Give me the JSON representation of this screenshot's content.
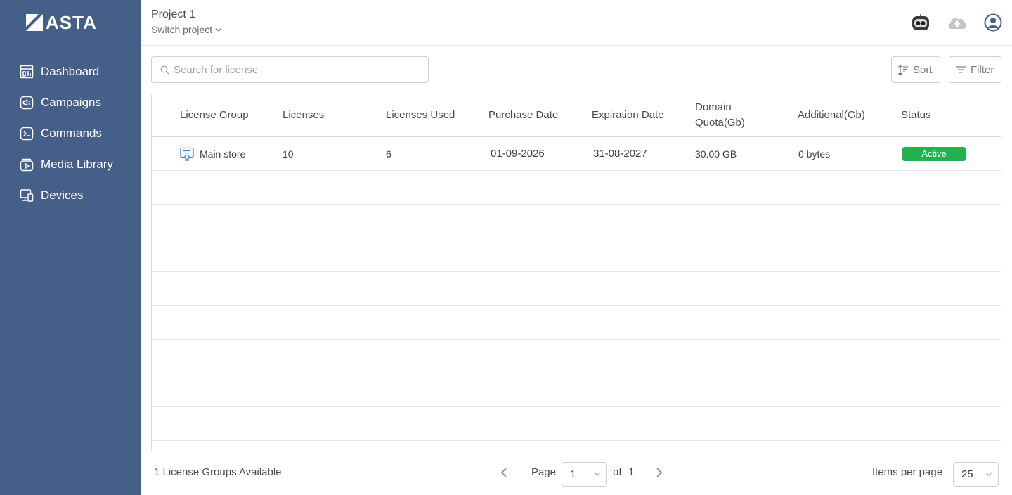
{
  "brand": {
    "name": "ASTA"
  },
  "sidebar": {
    "items": [
      {
        "label": "Dashboard",
        "icon": "dashboard-icon"
      },
      {
        "label": "Campaigns",
        "icon": "campaigns-icon"
      },
      {
        "label": "Commands",
        "icon": "commands-icon"
      },
      {
        "label": "Media Library",
        "icon": "media-library-icon"
      },
      {
        "label": "Devices",
        "icon": "devices-icon"
      }
    ]
  },
  "header": {
    "project_name": "Project 1",
    "switch_label": "Switch project",
    "icons": [
      "robot-icon",
      "cloud-upload-icon",
      "user-avatar-icon"
    ]
  },
  "search": {
    "placeholder": "Search for license",
    "value": ""
  },
  "toolbar": {
    "sort_label": "Sort",
    "filter_label": "Filter"
  },
  "table": {
    "columns": [
      "License Group",
      "Licenses",
      "Licenses Used",
      "Purchase Date",
      "Expiration Date",
      "Domain Quota(Gb)",
      "Additional(Gb)",
      "Status"
    ],
    "rows": [
      {
        "license_group": "Main store",
        "licenses": "10",
        "licenses_used": "6",
        "purchase_date": "01-09-2026",
        "expiration_date": "31-08-2027",
        "domain_quota": "30.00 GB",
        "additional": "0 bytes",
        "status": "Active"
      }
    ]
  },
  "footer": {
    "count_text": "1 License Groups Available",
    "page_label": "Page",
    "current_page": "1",
    "of_label": "of",
    "total_pages": "1",
    "items_per_page_label": "Items per page",
    "items_per_page": "25"
  },
  "colors": {
    "sidebar": "#455f89",
    "status_active": "#22b14c",
    "license_icon": "#3a86c8"
  }
}
